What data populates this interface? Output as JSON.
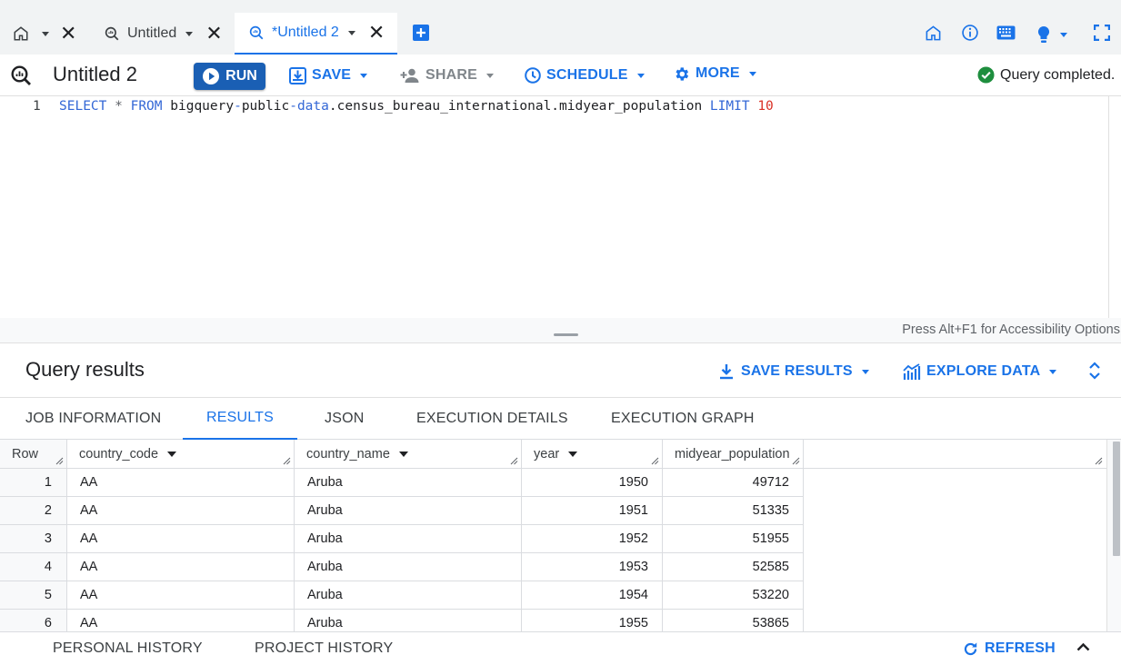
{
  "tabs": [
    {
      "label": ""
    },
    {
      "label": "Untitled"
    },
    {
      "label": "*Untitled 2"
    }
  ],
  "toolbar": {
    "title": "Untitled 2",
    "run_label": "RUN",
    "save_label": "SAVE",
    "share_label": "SHARE",
    "schedule_label": "SCHEDULE",
    "more_label": "MORE",
    "status": "Query completed."
  },
  "editor": {
    "line_number": "1",
    "tokens": {
      "select": "SELECT",
      "star": "*",
      "from": "FROM",
      "table_a": "bigquery",
      "dash1": "-",
      "table_b": "public",
      "dash2": "-",
      "table_c": "data",
      "table_d": ".census_bureau_international.midyear_population",
      "limit": "LIMIT",
      "limit_value": "10"
    },
    "accessibility_hint": "Press Alt+F1 for Accessibility Options"
  },
  "results": {
    "title": "Query results",
    "save_results_label": "SAVE RESULTS",
    "explore_data_label": "EXPLORE DATA",
    "tabs": [
      "JOB INFORMATION",
      "RESULTS",
      "JSON",
      "EXECUTION DETAILS",
      "EXECUTION GRAPH"
    ],
    "columns": [
      "Row",
      "country_code",
      "country_name",
      "year",
      "midyear_population"
    ],
    "rows": [
      [
        "1",
        "AA",
        "Aruba",
        "1950",
        "49712"
      ],
      [
        "2",
        "AA",
        "Aruba",
        "1951",
        "51335"
      ],
      [
        "3",
        "AA",
        "Aruba",
        "1952",
        "51955"
      ],
      [
        "4",
        "AA",
        "Aruba",
        "1953",
        "52585"
      ],
      [
        "5",
        "AA",
        "Aruba",
        "1954",
        "53220"
      ],
      [
        "6",
        "AA",
        "Aruba",
        "1955",
        "53865"
      ]
    ]
  },
  "footer": {
    "personal_history": "PERSONAL HISTORY",
    "project_history": "PROJECT HISTORY",
    "refresh": "REFRESH"
  },
  "colors": {
    "accent": "#1a73e8",
    "run_button": "#1a5fb4",
    "success": "#1e8e3e",
    "tab_strip": "#f1f3f4"
  }
}
